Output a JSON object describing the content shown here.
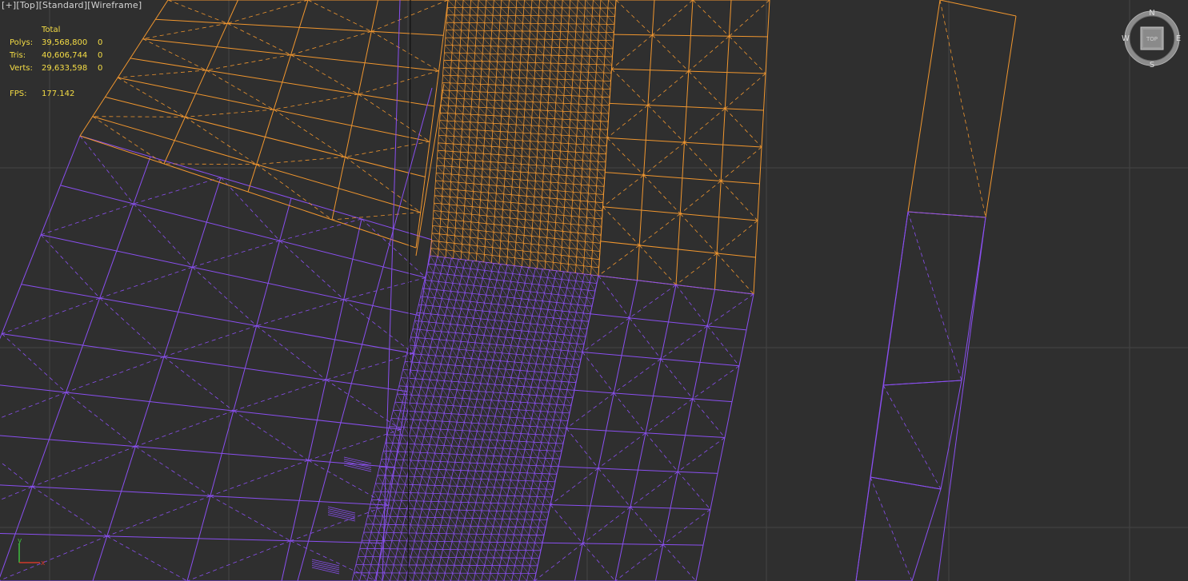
{
  "viewport": {
    "label_parts": [
      "[+]",
      "[Top]",
      "[Standard]",
      "[Wireframe]"
    ]
  },
  "stats": {
    "header": "Total",
    "rows": [
      {
        "label": "Polys:",
        "value": "39,568,800",
        "selected": "0"
      },
      {
        "label": "Tris:",
        "value": "40,606,744",
        "selected": "0"
      },
      {
        "label": "Verts:",
        "value": "29,633,598",
        "selected": "0"
      }
    ],
    "fps_label": "FPS:",
    "fps_value": "177.142"
  },
  "viewcube": {
    "north": "N",
    "south": "S",
    "east": "E",
    "west": "W",
    "face": "TOP"
  },
  "axis_tripod": {
    "y_label": "y",
    "x_label": "x"
  },
  "colors": {
    "background": "#2f2f2f",
    "grid": "#444444",
    "mesh_orange": "#f0962f",
    "mesh_purple": "#8a4ff0",
    "stats_text": "#f5dd45",
    "label_text": "#d4d4d4"
  }
}
